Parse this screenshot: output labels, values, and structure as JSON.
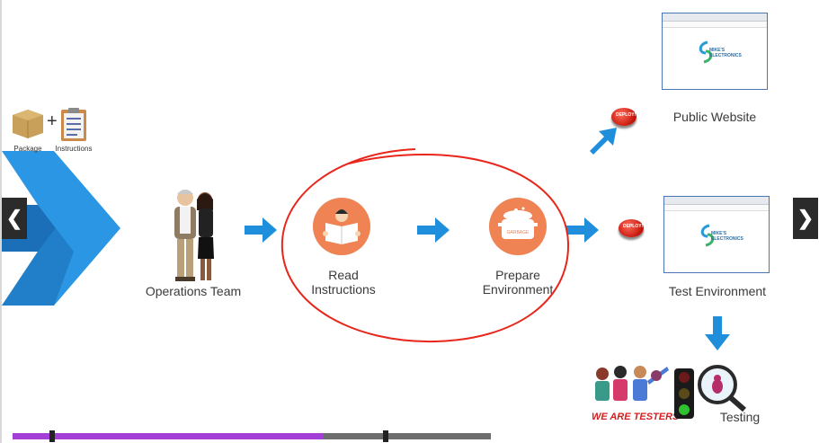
{
  "labels": {
    "package": "Package",
    "instructions": "Instructions",
    "operations_team": "Operations Team",
    "read_instructions": [
      "Read",
      "Instructions"
    ],
    "prepare_environment": [
      "Prepare",
      "Environment"
    ],
    "public_website": "Public Website",
    "test_environment": "Test Environment",
    "testing": "Testing",
    "we_are_testers": "WE ARE TESTERS",
    "deploy": "DEPLOY!",
    "logo_text": [
      "MIKE'S",
      "ELECTRONICS"
    ],
    "pot_label": "GARBAGE",
    "plus": "+"
  },
  "nav": {
    "prev": "❮",
    "next": "❯"
  },
  "progress": {
    "played_fraction": 0.65
  },
  "colors": {
    "arrow_blue": "#1f8fdc",
    "chevron_light": "#2b96e3",
    "chevron_dark": "#1b6fb9",
    "icon_orange": "#ef8354",
    "annotation_red": "#e8261b",
    "progress_purple": "#a33fd6"
  }
}
